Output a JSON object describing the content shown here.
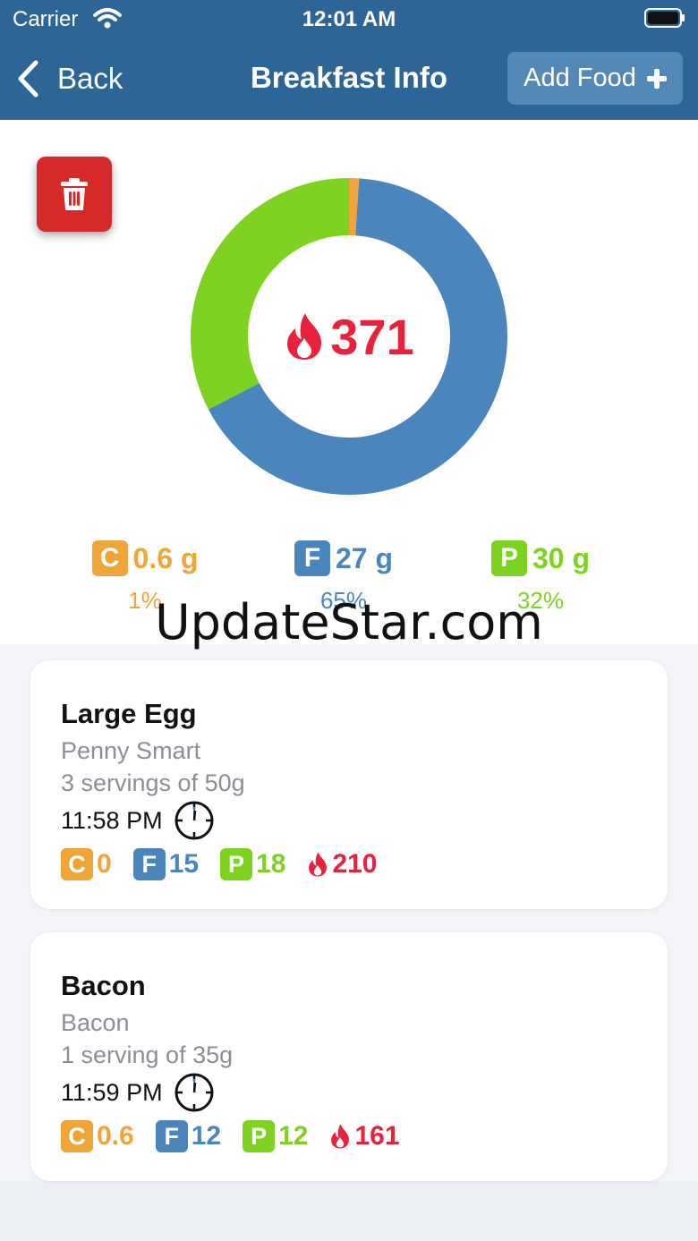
{
  "status_bar": {
    "carrier": "Carrier",
    "time": "12:01 AM"
  },
  "nav": {
    "back_label": "Back",
    "title": "Breakfast Info",
    "add_food_label": "Add Food"
  },
  "summary": {
    "calories": "371",
    "macros": [
      {
        "letter": "C",
        "amount": "0.6 g",
        "percent": "1%",
        "color": "#f0a43a",
        "fraction": 0.01
      },
      {
        "letter": "F",
        "amount": "27 g",
        "percent": "65%",
        "color": "#4a86bd",
        "fraction": 0.65
      },
      {
        "letter": "P",
        "amount": "30 g",
        "percent": "32%",
        "color": "#7ed321",
        "fraction": 0.32
      }
    ]
  },
  "watermark": "UpdateStar.com",
  "foods": [
    {
      "name": "Large Egg",
      "brand": "Penny Smart",
      "serving": "3 servings of 50g",
      "time": "11:58 PM",
      "carbs": "0",
      "fat": "15",
      "protein": "18",
      "calories": "210"
    },
    {
      "name": "Bacon",
      "brand": "Bacon",
      "serving": "1 serving of 35g",
      "time": "11:59 PM",
      "carbs": "0.6",
      "fat": "12",
      "protein": "12",
      "calories": "161"
    }
  ],
  "colors": {
    "header": "#2e6597",
    "carbs": "#f0a43a",
    "fat": "#4a86bd",
    "protein": "#7ed321",
    "calories": "#e8213f",
    "delete": "#d62a2a"
  },
  "icons": [
    "wifi-icon",
    "battery-icon",
    "back-chevron-icon",
    "plus-icon",
    "trash-icon",
    "flame-icon",
    "clock-icon"
  ]
}
